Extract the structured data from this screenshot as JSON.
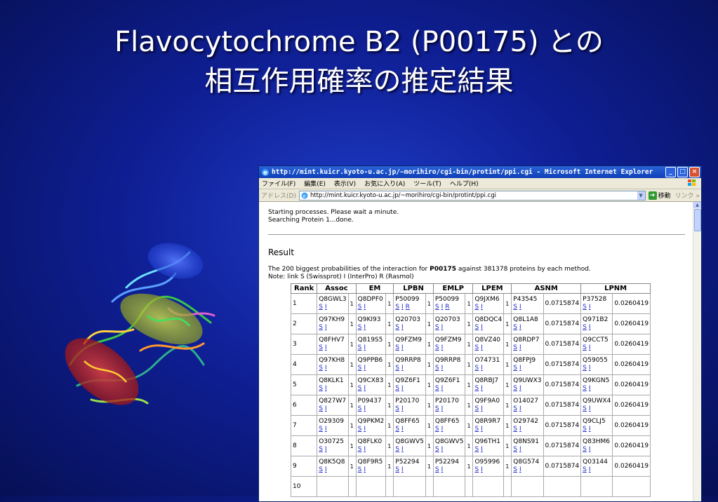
{
  "slide": {
    "title_line1": "Flavocytochrome B2 (P00175) との",
    "title_line2": "相互作用確率の推定結果"
  },
  "window": {
    "title": "http://mint.kuicr.kyoto-u.ac.jp/~morihiro/cgi-bin/protint/ppi.cgi - Microsoft Internet Explorer",
    "menu": [
      "ファイル(F)",
      "編集(E)",
      "表示(V)",
      "お気に入り(A)",
      "ツール(T)",
      "ヘルプ(H)"
    ],
    "address_label": "アドレス(D)",
    "address_value": "http://mint.kuicr.kyoto-u.ac.jp/~morihiro/cgi-bin/protint/ppi.cgi",
    "go_label": "移動",
    "links_label": "リンク »"
  },
  "page": {
    "status1": "Starting processes. Please wait a minute.",
    "status2": "Searching Protein 1...done.",
    "result_heading": "Result",
    "desc_prefix": "The 200 biggest probabilities of the interaction for ",
    "desc_protein": "P00175",
    "desc_suffix": " against 381378 proteins by each method.",
    "note": "Note: link S (Swissprot) I (InterPro) R (Rasmol)"
  },
  "table": {
    "headers": [
      "Rank",
      "Assoc",
      "EM",
      "LPBN",
      "EMLP",
      "LPEM",
      "ASNM",
      "LPNM"
    ],
    "rows": [
      {
        "rank": "1",
        "assoc": "Q8GWL3",
        "em": "Q8DPF0",
        "lpbn": "P50099",
        "emlp": "P50099",
        "lpem": "Q9JXM6",
        "asnm": "P43545",
        "asnm_score": "0.0715874",
        "lpnm": "P37528",
        "lpnm_score": "0.0260419"
      },
      {
        "rank": "2",
        "assoc": "Q97KH9",
        "em": "Q9KI93",
        "lpbn": "Q20703",
        "emlp": "Q20703",
        "lpem": "Q8DQC4",
        "asnm": "Q8L1A8",
        "asnm_score": "0.0715874",
        "lpnm": "Q971B2",
        "lpnm_score": "0.0260419"
      },
      {
        "rank": "3",
        "assoc": "Q8FHV7",
        "em": "Q819S5",
        "lpbn": "Q9FZM9",
        "emlp": "Q9FZM9",
        "lpem": "Q8VZ40",
        "asnm": "Q8RDP7",
        "asnm_score": "0.0715874",
        "lpnm": "Q9CCT5",
        "lpnm_score": "0.0260419"
      },
      {
        "rank": "4",
        "assoc": "Q97KH8",
        "em": "Q9PPB6",
        "lpbn": "Q9RRP8",
        "emlp": "Q9RRP8",
        "lpem": "O74731",
        "asnm": "Q8FPJ9",
        "asnm_score": "0.0715874",
        "lpnm": "Q59055",
        "lpnm_score": "0.0260419"
      },
      {
        "rank": "5",
        "assoc": "Q8KLK1",
        "em": "Q9CX83",
        "lpbn": "Q9Z6F1",
        "emlp": "Q9Z6F1",
        "lpem": "Q8RBJ7",
        "asnm": "Q9UWX3",
        "asnm_score": "0.0715874",
        "lpnm": "Q9KGN5",
        "lpnm_score": "0.0260419"
      },
      {
        "rank": "6",
        "assoc": "Q827W7",
        "em": "P09437",
        "lpbn": "P20170",
        "emlp": "P20170",
        "lpem": "Q9F9A0",
        "asnm": "O14027",
        "asnm_score": "0.0715874",
        "lpnm": "Q9UWX4",
        "lpnm_score": "0.0260419"
      },
      {
        "rank": "7",
        "assoc": "O29309",
        "em": "Q9PKM2",
        "lpbn": "Q8FF65",
        "emlp": "Q8FF65",
        "lpem": "Q8R9R7",
        "asnm": "O29742",
        "asnm_score": "0.0715874",
        "lpnm": "Q9CLJ5",
        "lpnm_score": "0.0260419"
      },
      {
        "rank": "8",
        "assoc": "O30725",
        "em": "Q8FLK0",
        "lpbn": "Q8GWV5",
        "emlp": "Q8GWV5",
        "lpem": "Q96TH1",
        "asnm": "Q8NS91",
        "asnm_score": "0.0715874",
        "lpnm": "Q83HM6",
        "lpnm_score": "0.0260419"
      },
      {
        "rank": "9",
        "assoc": "Q8K5Q8",
        "em": "Q8F9R5",
        "lpbn": "P52294",
        "emlp": "P52294",
        "lpem": "O95996",
        "asnm": "Q8G574",
        "asnm_score": "0.0715874",
        "lpnm": "Q03144",
        "lpnm_score": "0.0260419"
      },
      {
        "rank": "10",
        "assoc": "",
        "em": "",
        "lpbn": "",
        "emlp": "",
        "lpem": "",
        "asnm": "",
        "asnm_score": "",
        "lpnm": "",
        "lpnm_score": ""
      }
    ],
    "one": "1",
    "link_s": "S",
    "link_i": "I",
    "link_r": "R"
  }
}
